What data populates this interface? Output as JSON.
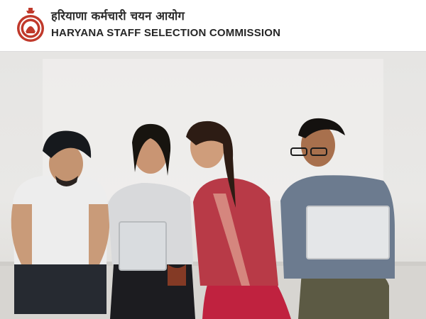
{
  "header": {
    "title_hindi": "हरियाणा कर्मचारी चयन आयोग",
    "title_english": "HARYANA STAFF SELECTION COMMISSION",
    "logo_icon": "haryana-emblem-icon"
  },
  "hero": {
    "image_icon": "students-with-laptops-photo"
  },
  "colors": {
    "header_bg": "#ffffff",
    "page_bg": "#e7e6e4",
    "emblem": "#c0392b"
  }
}
